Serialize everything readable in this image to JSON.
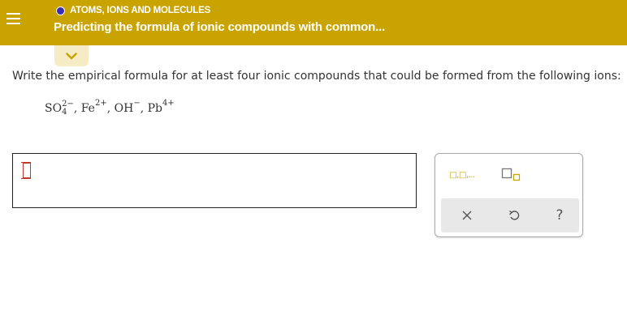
{
  "header": {
    "topic": "ATOMS, IONS AND MOLECULES",
    "title": "Predicting the formula of ionic compounds with common..."
  },
  "question": {
    "text": "Write the empirical formula for at least four ionic compounds that could be formed from the following ions:",
    "ions": [
      {
        "base": "SO",
        "sub": "4",
        "charge": "2−"
      },
      {
        "base": "Fe",
        "charge": "2+"
      },
      {
        "base": "OH",
        "charge": "−"
      },
      {
        "base": "Pb",
        "charge": "4+"
      }
    ],
    "separator": ","
  },
  "answer": {
    "value": ""
  },
  "tools": {
    "list_icon_label": "□,□,...",
    "actions": [
      "clear",
      "undo",
      "help"
    ],
    "help_label": "?"
  },
  "colors": {
    "header_bg": "#c9a300",
    "topic_dot": "#3a2bb5",
    "tab_bg": "#f5ecc6",
    "icon_gold": "#c9a300"
  }
}
